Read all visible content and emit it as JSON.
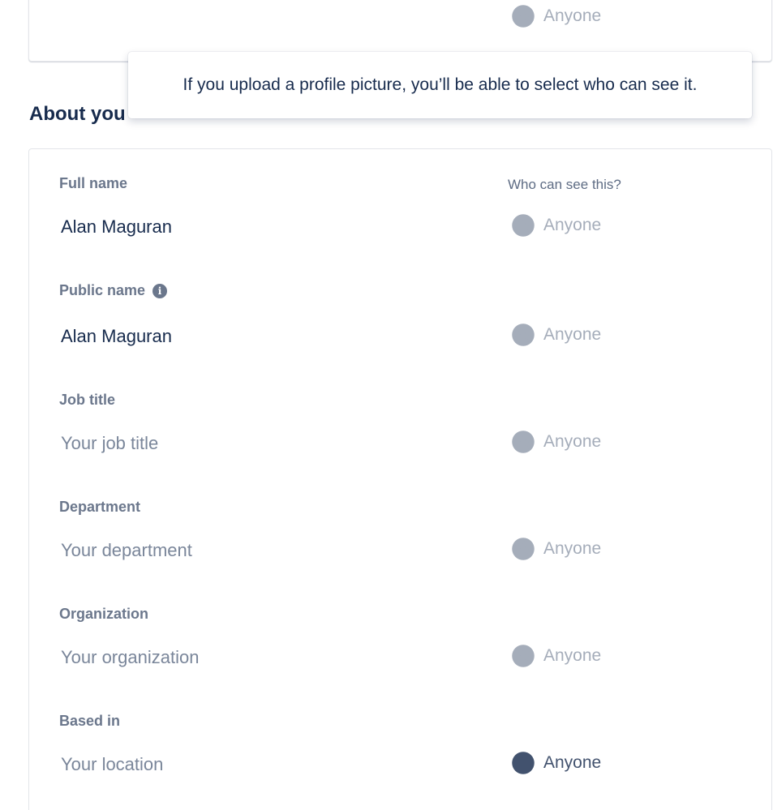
{
  "top_visibility": "Anyone",
  "tooltip_text": "If you upload a profile picture, you’ll be able to select who can see it.",
  "section_title": "About you",
  "who_can_see_header": "Who can see this?",
  "fields": [
    {
      "label": "Full name",
      "value": "Alan Maguran",
      "visibility": "Anyone"
    },
    {
      "label": "Public name",
      "value": "Alan Maguran",
      "visibility": "Anyone"
    },
    {
      "label": "Job title",
      "placeholder": "Your job title",
      "visibility": "Anyone"
    },
    {
      "label": "Department",
      "placeholder": "Your department",
      "visibility": "Anyone"
    },
    {
      "label": "Organization",
      "placeholder": "Your organization",
      "visibility": "Anyone"
    },
    {
      "label": "Based in",
      "placeholder": "Your location",
      "visibility": "Anyone"
    }
  ],
  "colors": {
    "heading": "#172b4d",
    "label": "#6b778c",
    "placeholder": "#7a869a",
    "muted_visibility": "#a5adba",
    "active_visibility": "#42526e"
  },
  "icons": {
    "visibility": "globe-icon",
    "info": "info-icon"
  }
}
